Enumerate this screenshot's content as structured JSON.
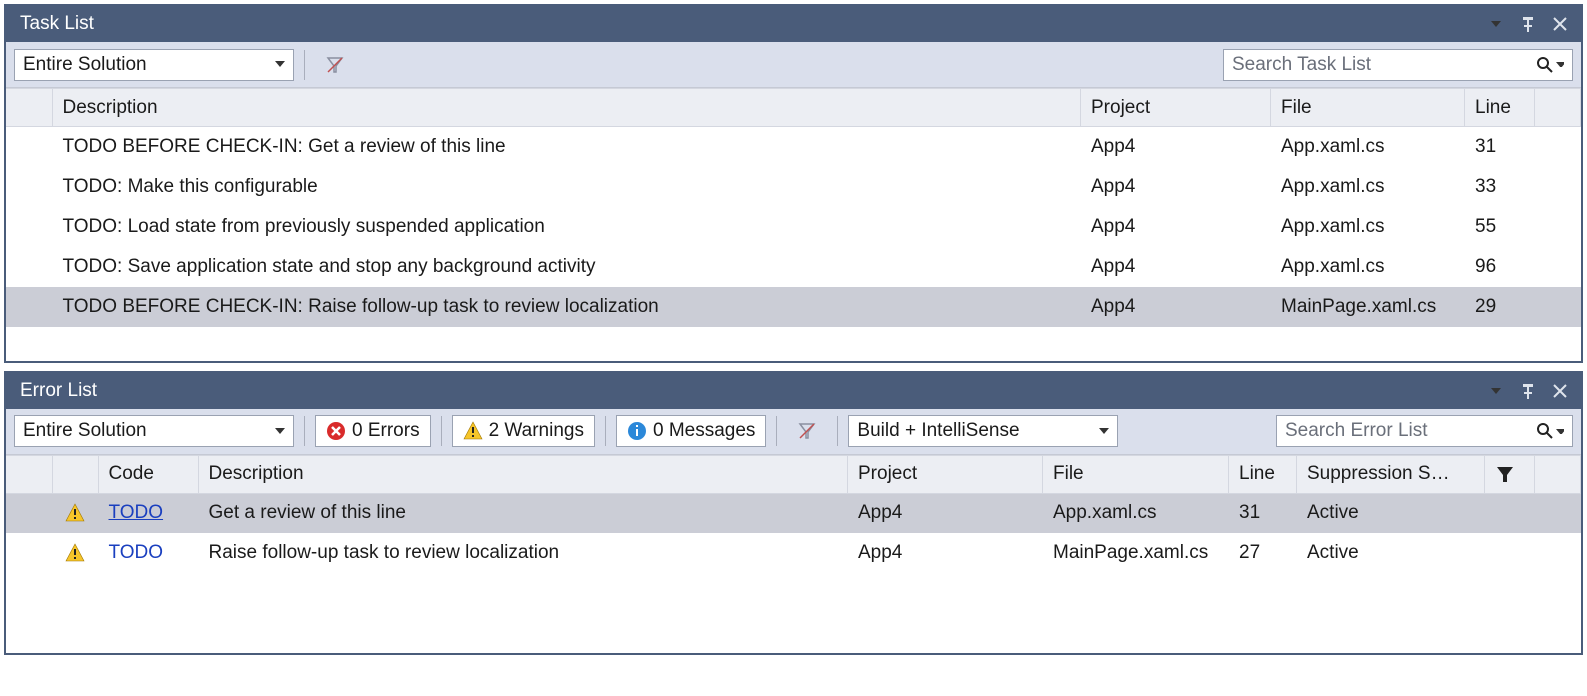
{
  "taskList": {
    "title": "Task List",
    "scope": "Entire Solution",
    "searchPlaceholder": "Search Task List",
    "columns": {
      "c0": "",
      "c1": "Description",
      "c2": "Project",
      "c3": "File",
      "c4": "Line"
    },
    "rows": [
      {
        "desc": "TODO BEFORE CHECK-IN: Get a review of this line",
        "project": "App4",
        "file": "App.xaml.cs",
        "line": "31",
        "selected": false
      },
      {
        "desc": "TODO: Make this configurable",
        "project": "App4",
        "file": "App.xaml.cs",
        "line": "33",
        "selected": false
      },
      {
        "desc": "TODO: Load state from previously suspended application",
        "project": "App4",
        "file": "App.xaml.cs",
        "line": "55",
        "selected": false
      },
      {
        "desc": "TODO: Save application state and stop any background activity",
        "project": "App4",
        "file": "App.xaml.cs",
        "line": "96",
        "selected": false
      },
      {
        "desc": "TODO BEFORE CHECK-IN: Raise follow-up task to review localization",
        "project": "App4",
        "file": "MainPage.xaml.cs",
        "line": "29",
        "selected": true
      }
    ]
  },
  "errorList": {
    "title": "Error List",
    "scope": "Entire Solution",
    "errorsLabel": "0 Errors",
    "warningsLabel": "2 Warnings",
    "messagesLabel": "0 Messages",
    "source": "Build + IntelliSense",
    "searchPlaceholder": "Search Error List",
    "columns": {
      "c0": "",
      "c1": "",
      "c2": "Code",
      "c3": "Description",
      "c4": "Project",
      "c5": "File",
      "c6": "Line",
      "c7": "Suppression S…"
    },
    "rows": [
      {
        "icon": "warn",
        "code": "TODO",
        "codeLink": true,
        "desc": "Get a review of this line",
        "project": "App4",
        "file": "App.xaml.cs",
        "line": "31",
        "supp": "Active",
        "selected": true
      },
      {
        "icon": "warn",
        "code": "TODO",
        "codeLink": false,
        "desc": "Raise follow-up task to review localization",
        "project": "App4",
        "file": "MainPage.xaml.cs",
        "line": "27",
        "supp": "Active",
        "selected": false
      }
    ]
  }
}
